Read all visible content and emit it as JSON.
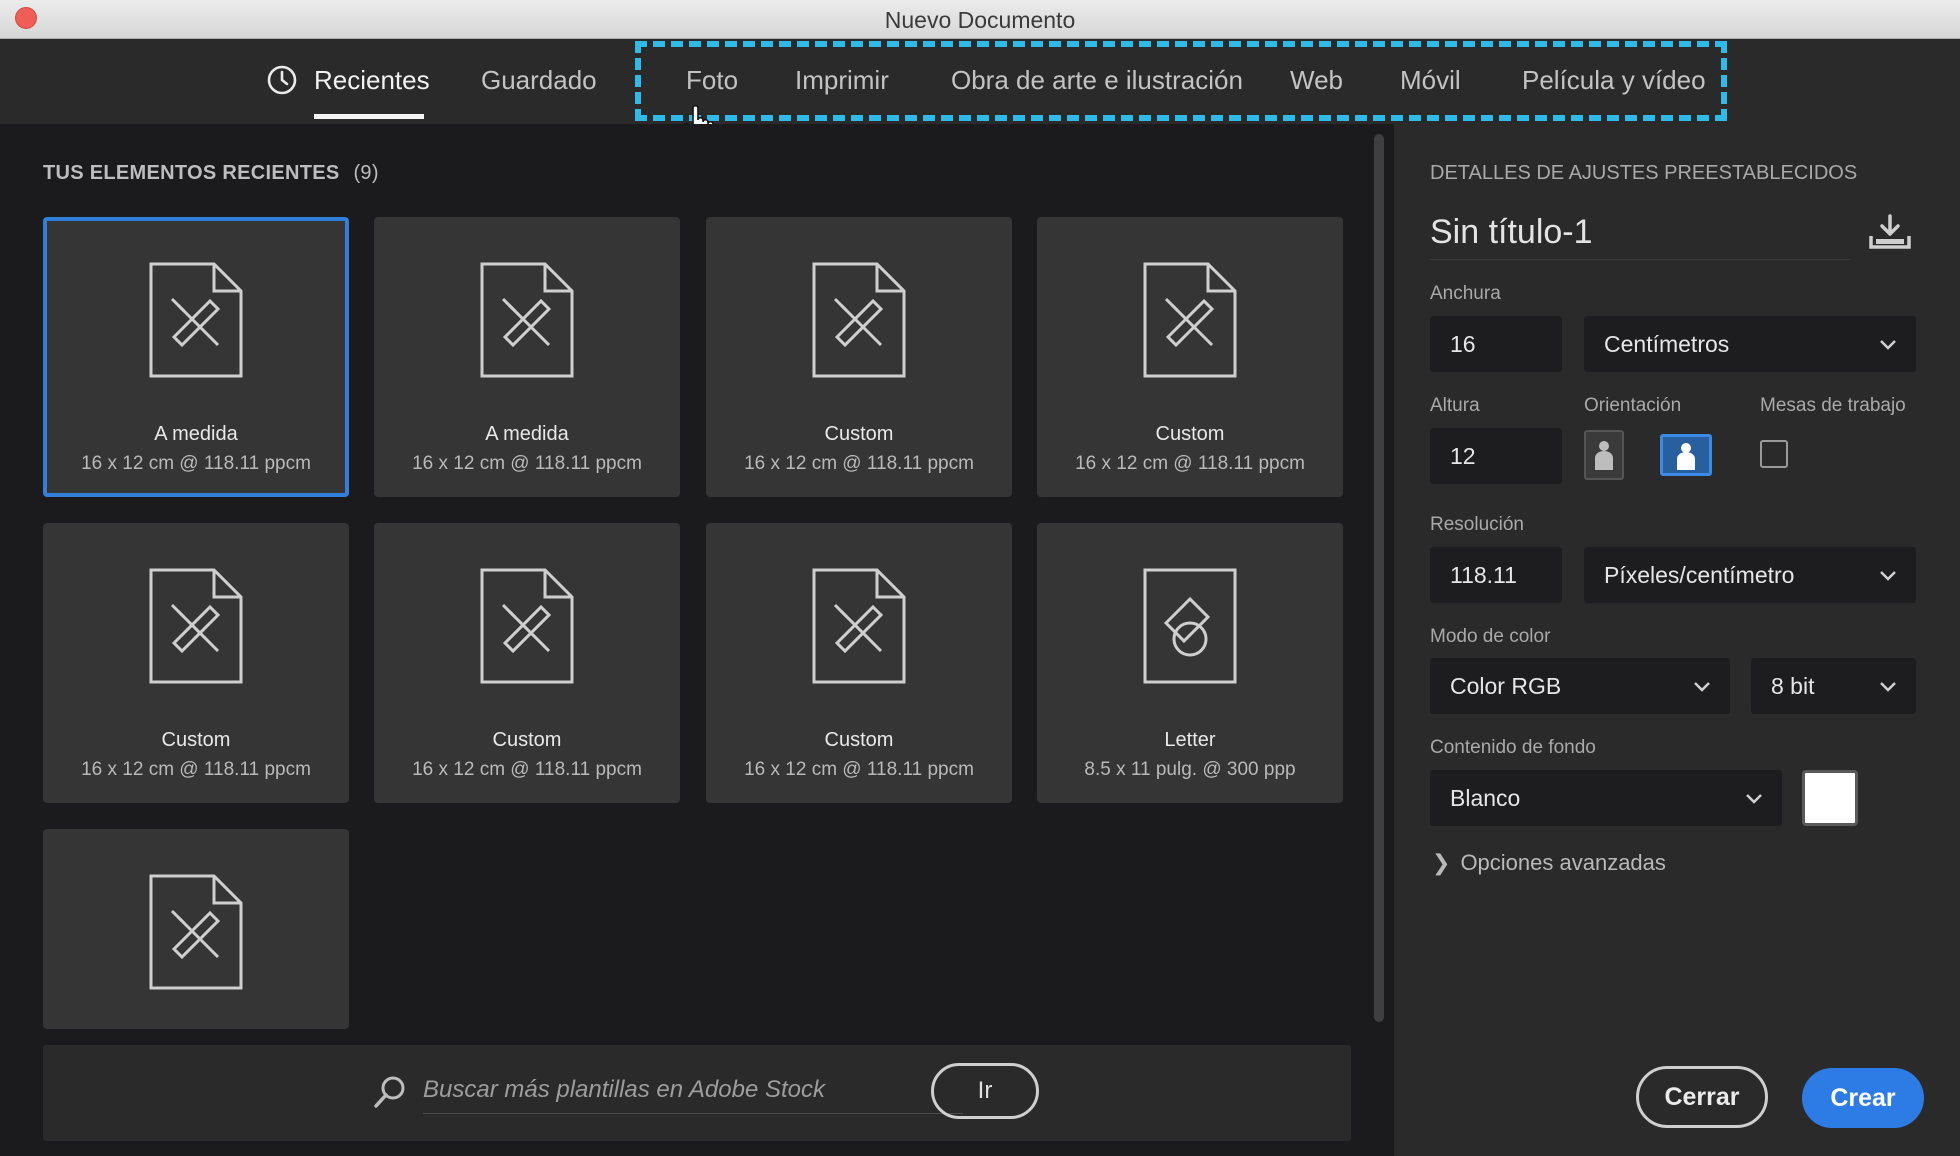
{
  "window": {
    "title": "Nuevo Documento"
  },
  "tabs": [
    {
      "label": "Recientes",
      "active": true
    },
    {
      "label": "Guardado"
    },
    {
      "label": "Foto"
    },
    {
      "label": "Imprimir"
    },
    {
      "label": "Obra de arte e ilustración"
    },
    {
      "label": "Web"
    },
    {
      "label": "Móvil"
    },
    {
      "label": "Película y vídeo"
    }
  ],
  "recent": {
    "title": "TUS ELEMENTOS RECIENTES",
    "count": "(9)",
    "items": [
      {
        "name": "A medida",
        "sub": "16 x 12 cm @ 118.11 ppcm",
        "icon": "artboard-document-icon",
        "selected": true
      },
      {
        "name": "A medida",
        "sub": "16 x 12 cm @ 118.11 ppcm",
        "icon": "artboard-document-icon"
      },
      {
        "name": "Custom",
        "sub": "16 x 12 cm @ 118.11 ppcm",
        "icon": "artboard-document-icon"
      },
      {
        "name": "Custom",
        "sub": "16 x 12 cm @ 118.11 ppcm",
        "icon": "artboard-document-icon"
      },
      {
        "name": "Custom",
        "sub": "16 x 12 cm @ 118.11 ppcm",
        "icon": "artboard-document-icon"
      },
      {
        "name": "Custom",
        "sub": "16 x 12 cm @ 118.11 ppcm",
        "icon": "artboard-document-icon"
      },
      {
        "name": "Custom",
        "sub": "16 x 12 cm @ 118.11 ppcm",
        "icon": "artboard-document-icon"
      },
      {
        "name": "Letter",
        "sub": "8.5 x 11 pulg. @ 300 ppp",
        "icon": "shapes-document-icon"
      },
      {
        "name": "",
        "sub": "",
        "icon": "artboard-document-icon"
      }
    ]
  },
  "search": {
    "placeholder": "Buscar más plantillas en Adobe Stock",
    "go_label": "Ir"
  },
  "preset": {
    "section_title": "DETALLES DE AJUSTES PREESTABLECIDOS",
    "doc_title": "Sin título-1",
    "width_label": "Anchura",
    "width_value": "16",
    "width_unit": "Centímetros",
    "height_label": "Altura",
    "height_value": "12",
    "orientation_label": "Orientación",
    "artboards_label": "Mesas de trabajo",
    "resolution_label": "Resolución",
    "resolution_value": "118.11",
    "resolution_unit": "Píxeles/centímetro",
    "color_mode_label": "Modo de color",
    "color_mode": "Color RGB",
    "bit_depth": "8 bit",
    "background_label": "Contenido de fondo",
    "background": "Blanco",
    "background_swatch": "#ffffff",
    "advanced_label": "Opciones avanzadas"
  },
  "buttons": {
    "close": "Cerrar",
    "create": "Crear"
  },
  "colors": {
    "accent": "#2d7ce6",
    "highlight_dash": "#2ebbe8",
    "close_dot": "#ee5e56"
  }
}
